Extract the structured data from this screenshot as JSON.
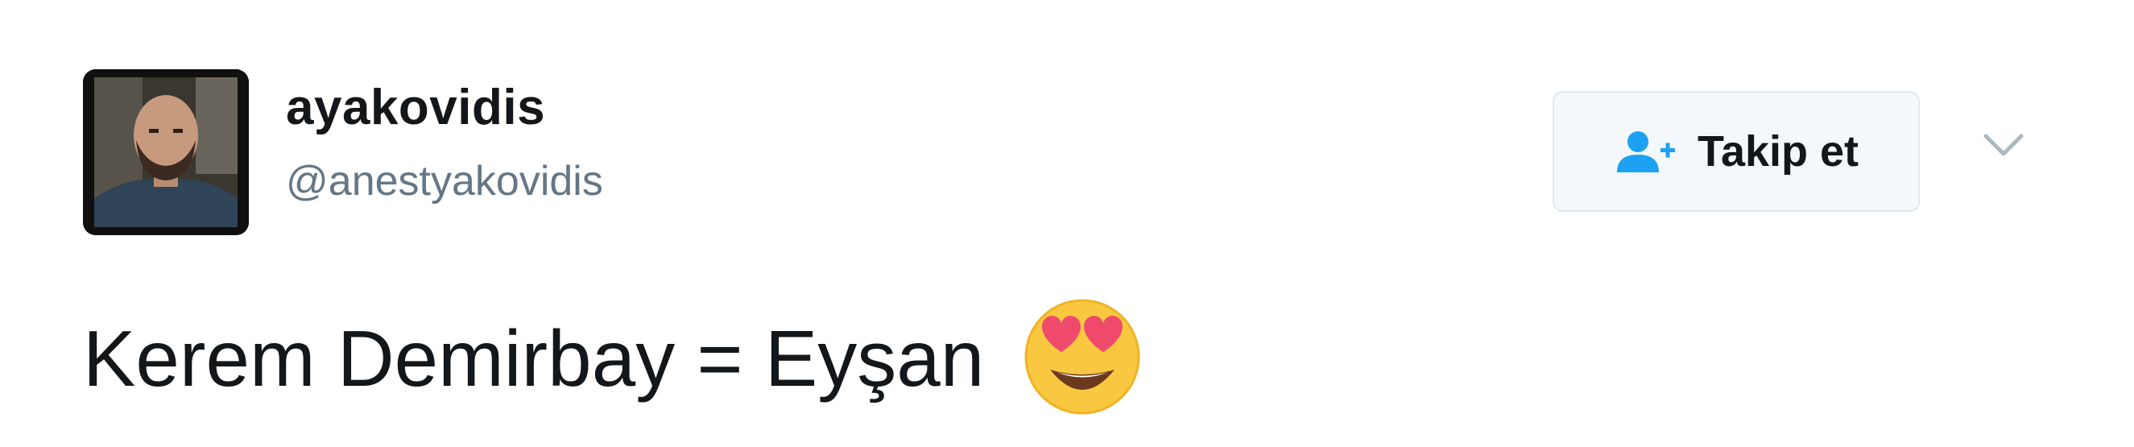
{
  "user": {
    "display_name": "ayakovidis",
    "screen_name": "@anestyakovidis",
    "avatar_icon": "profile-photo"
  },
  "follow_button": {
    "label": "Takip et",
    "icon": "add-user-icon"
  },
  "caret": {
    "icon": "chevron-down-icon"
  },
  "tweet": {
    "text": "Kerem Demirbay = Eyşan",
    "emoji": "smiling-face-with-heart-eyes"
  },
  "colors": {
    "text_primary": "#14171a",
    "text_secondary": "#657786",
    "accent": "#1da1f2",
    "button_bg": "#f5f8fa",
    "button_border": "#e1e8ed"
  }
}
